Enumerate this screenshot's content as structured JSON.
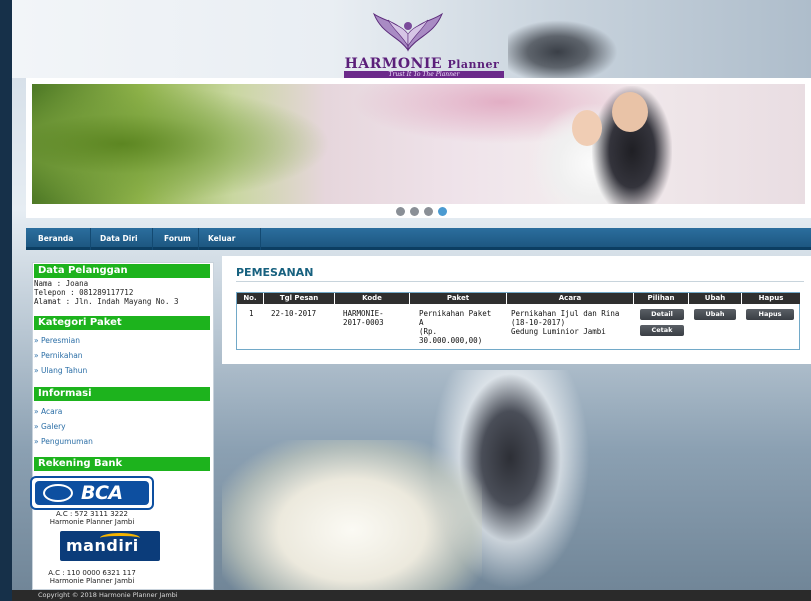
{
  "brand": {
    "name": "HARMONIE",
    "name_suffix": "Planner",
    "tagline": "Trust It To The Planner"
  },
  "slider": {
    "dots": 4,
    "active_dot": 4
  },
  "nav": {
    "items": [
      "Beranda",
      "Data Diri",
      "Forum",
      "Keluar"
    ]
  },
  "sidebar": {
    "customer": {
      "heading": "Data Pelanggan",
      "lines": [
        "Nama : Joana",
        "Telepon : 081289117712",
        "Alamat : Jln. Indah Mayang No. 3"
      ]
    },
    "packages": {
      "heading": "Kategori Paket",
      "links": [
        "Peresmian",
        "Pernikahan",
        "Ulang Tahun"
      ]
    },
    "info": {
      "heading": "Informasi",
      "links": [
        "Acara",
        "Galery",
        "Pengumuman"
      ]
    },
    "bank": {
      "heading": "Rekening Bank",
      "accounts": [
        {
          "bank": "BCA",
          "account": "A.C : 572 3111 3222",
          "holder": "Harmonie Planner Jambi"
        },
        {
          "bank": "mandiri",
          "account": "A.C : 110 0000 6321 117",
          "holder": "Harmonie Planner Jambi"
        }
      ]
    }
  },
  "main": {
    "title": "PEMESANAN",
    "columns": [
      "No.",
      "Tgl Pesan",
      "Kode",
      "Paket",
      "Acara",
      "Pilihan",
      "Ubah",
      "Hapus"
    ],
    "rows": [
      {
        "no": "1",
        "tgl": "22-10-2017",
        "kode": [
          "HARMONIE-",
          "2017-0003"
        ],
        "paket": [
          "Pernikahan Paket",
          "A",
          "(Rp.",
          "30.000.000,00)"
        ],
        "acara": [
          "Pernikahan Ijul dan Rina",
          "(18-10-2017)",
          "Gedung Luminior Jambi"
        ],
        "btn_detail": "Detail",
        "btn_cetak": "Cetak",
        "btn_ubah": "Ubah",
        "btn_hapus": "Hapus"
      }
    ]
  },
  "footer": {
    "text": "Copyright © 2018 Harmonie Planner Jambi"
  },
  "colors": {
    "accent_green": "#1db31d",
    "nav_blue": "#1d5781",
    "title_blue": "#17617f"
  }
}
